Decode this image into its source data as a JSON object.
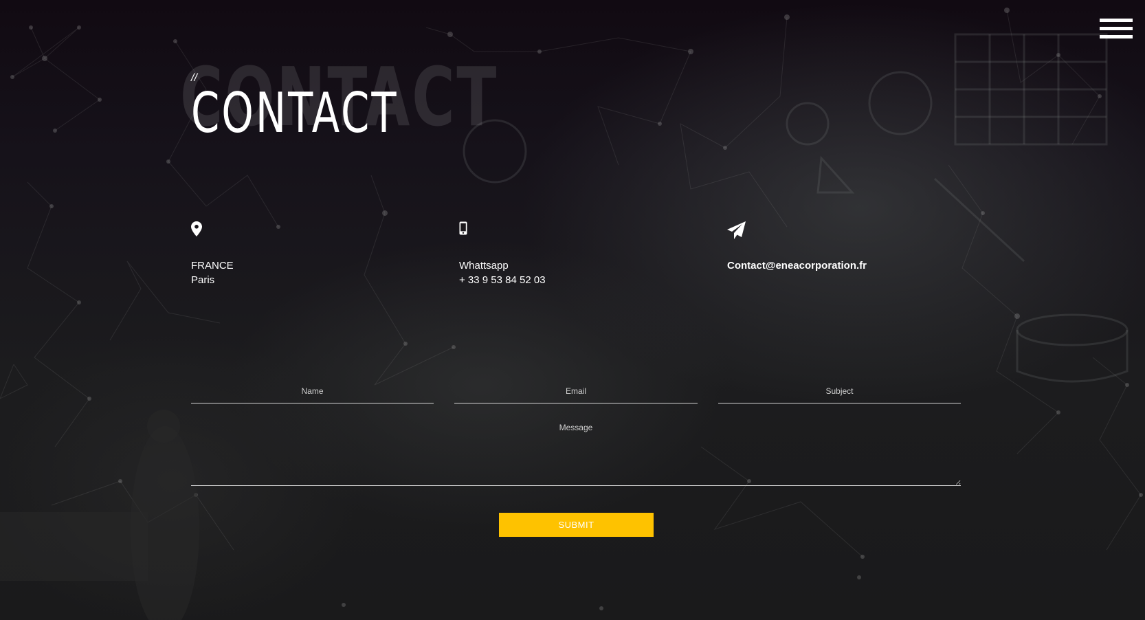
{
  "header": {
    "menu_icon": "hamburger-menu-icon",
    "title_ghost": "CONTACT",
    "title_prefix": "//",
    "title": "CONTACT"
  },
  "contact_info": {
    "location": {
      "icon": "map-pin-icon",
      "line1": "FRANCE",
      "line2": "Paris"
    },
    "phone": {
      "icon": "mobile-phone-icon",
      "line1": "Whattsapp",
      "line2": "+ 33 9 53 84 52 03"
    },
    "email": {
      "icon": "paper-plane-icon",
      "line1": "Contact@eneacorporation.fr"
    }
  },
  "form": {
    "name_placeholder": "Name",
    "email_placeholder": "Email",
    "subject_placeholder": "Subject",
    "message_placeholder": "Message",
    "submit_label": "SUBMIT"
  },
  "colors": {
    "accent": "#fec200",
    "text": "#ffffff",
    "background": "#171519"
  }
}
